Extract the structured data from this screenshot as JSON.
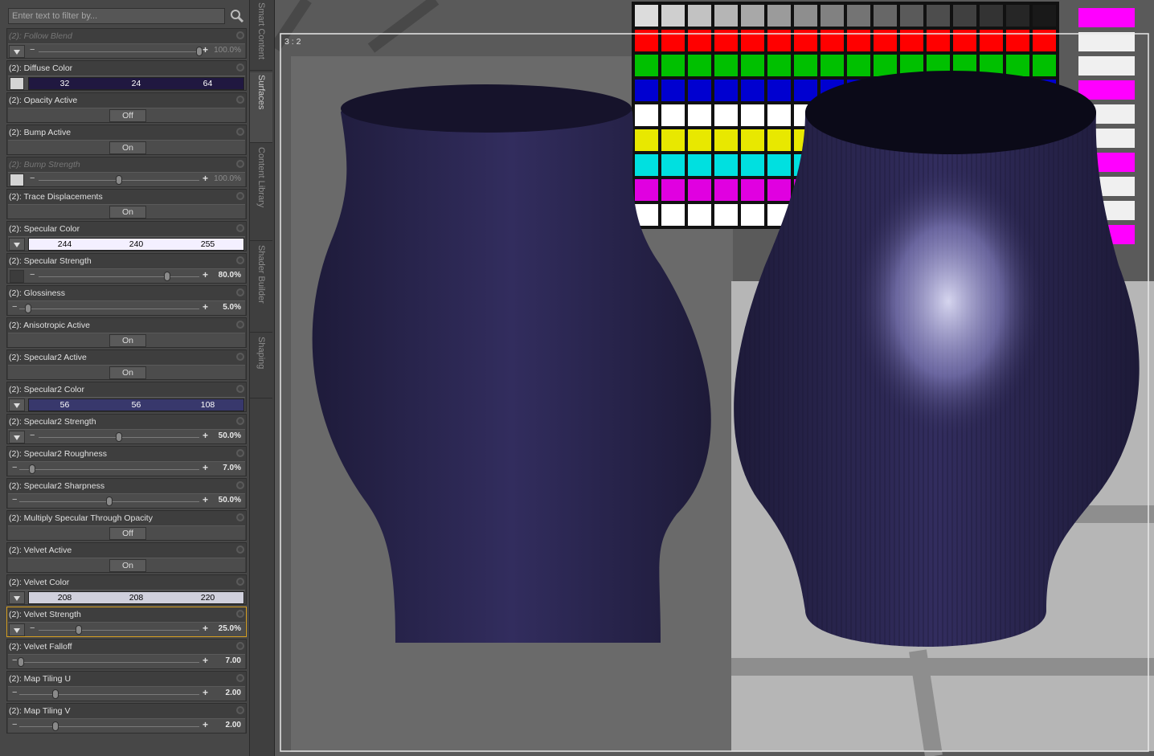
{
  "filter": {
    "placeholder": "Enter text to filter by...",
    "search_icon": "magnifier"
  },
  "side_tabs": [
    "Smart Content",
    "Surfaces",
    "Content Library",
    "Shader Builder",
    "Shaping"
  ],
  "viewport": {
    "aspect_label": "3 : 2"
  },
  "properties": [
    {
      "label": "(2): Follow Blend",
      "kind": "slider",
      "value": "100.0%",
      "fraction": 1.0,
      "dim": true,
      "arrow": true
    },
    {
      "label": "(2): Diffuse Color",
      "kind": "color",
      "rgb": [
        "32",
        "24",
        "64"
      ],
      "hex": "#201840",
      "text": "#ffffff"
    },
    {
      "label": "(2): Opacity Active",
      "kind": "toggle",
      "value": "Off"
    },
    {
      "label": "(2): Bump Active",
      "kind": "toggle",
      "value": "On"
    },
    {
      "label": "(2): Bump Strength",
      "kind": "slider",
      "value": "100.0%",
      "fraction": 0.5,
      "dim": true,
      "swatch": true
    },
    {
      "label": "(2): Trace Displacements",
      "kind": "toggle",
      "value": "On"
    },
    {
      "label": "(2): Specular Color",
      "kind": "color",
      "rgb": [
        "244",
        "240",
        "255"
      ],
      "hex": "#f4f0ff",
      "text": "#000000"
    },
    {
      "label": "(2): Specular Strength",
      "kind": "slider",
      "value": "80.0%",
      "fraction": 0.8,
      "swatch_dark": true
    },
    {
      "label": "(2): Glossiness",
      "kind": "slider",
      "value": "5.0%",
      "fraction": 0.05,
      "wide": true
    },
    {
      "label": "(2): Anisotropic Active",
      "kind": "toggle",
      "value": "On"
    },
    {
      "label": "(2): Specular2 Active",
      "kind": "toggle",
      "value": "On"
    },
    {
      "label": "(2): Specular2 Color",
      "kind": "color",
      "rgb": [
        "56",
        "56",
        "108"
      ],
      "hex": "#38386c",
      "text": "#ffffff"
    },
    {
      "label": "(2): Specular2 Strength",
      "kind": "slider",
      "value": "50.0%",
      "fraction": 0.5,
      "arrow": true
    },
    {
      "label": "(2): Specular2 Roughness",
      "kind": "slider",
      "value": "7.0%",
      "fraction": 0.07,
      "wide": true
    },
    {
      "label": "(2): Specular2 Sharpness",
      "kind": "slider",
      "value": "50.0%",
      "fraction": 0.5,
      "wide": true
    },
    {
      "label": "(2): Multiply Specular Through Opacity",
      "kind": "toggle",
      "value": "Off"
    },
    {
      "label": "(2): Velvet Active",
      "kind": "toggle",
      "value": "On"
    },
    {
      "label": "(2): Velvet Color",
      "kind": "color",
      "rgb": [
        "208",
        "208",
        "220"
      ],
      "hex": "#d0d0dc",
      "text": "#000000"
    },
    {
      "label": "(2): Velvet Strength",
      "kind": "slider",
      "value": "25.0%",
      "fraction": 0.25,
      "arrow": true,
      "selected": true
    },
    {
      "label": "(2): Velvet Falloff",
      "kind": "slider",
      "value": "7.00",
      "fraction": 0.01,
      "wide": true
    },
    {
      "label": "(2): Map Tiling U",
      "kind": "slider",
      "value": "2.00",
      "fraction": 0.2,
      "wide": true
    },
    {
      "label": "(2): Map Tiling V",
      "kind": "slider",
      "value": "2.00",
      "fraction": 0.2,
      "wide": true
    }
  ],
  "colors": {
    "panel": "#474747",
    "selected_border": "#d8a020",
    "vase": "#2e2a55",
    "highlight": "#d8d8f0"
  }
}
